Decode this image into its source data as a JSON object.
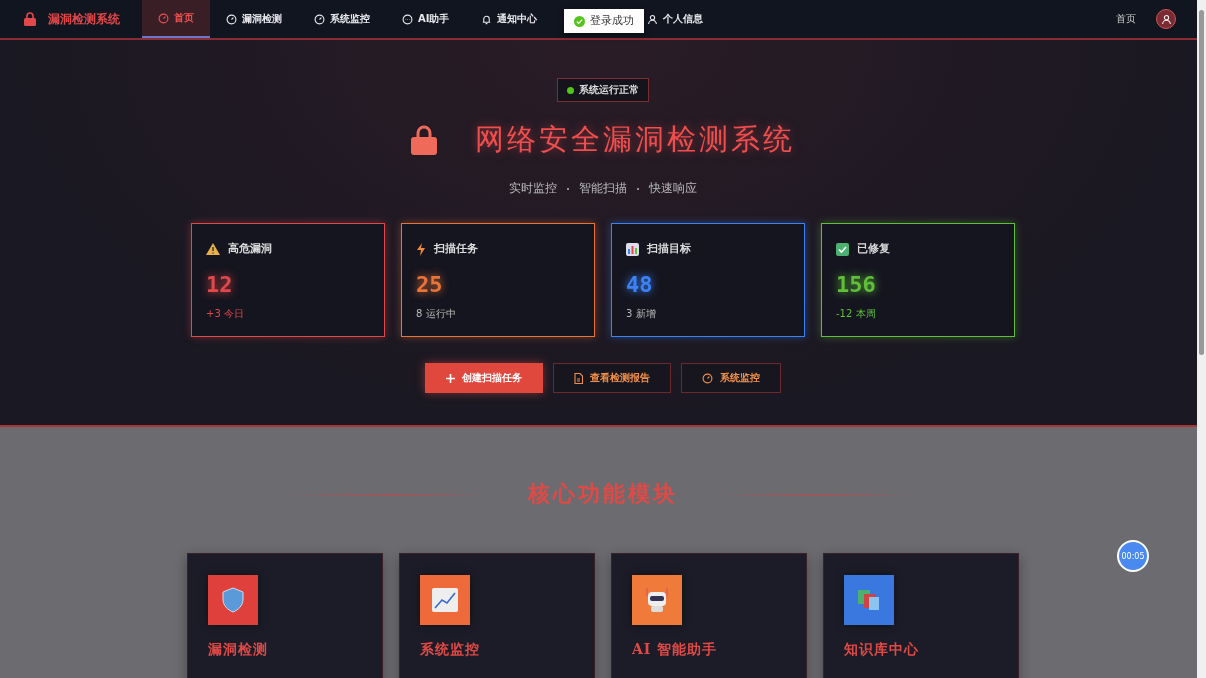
{
  "navbar": {
    "brand": "漏洞检测系统",
    "items": [
      {
        "label": "首页",
        "selected": true
      },
      {
        "label": "漏洞检测",
        "selected": false
      },
      {
        "label": "系统监控",
        "selected": false
      },
      {
        "label": "AI助手",
        "selected": false
      },
      {
        "label": "通知中心",
        "selected": false
      },
      {
        "label": "个人信息",
        "selected": false
      }
    ],
    "breadcrumb": "首页"
  },
  "toast": {
    "text": "登录成功"
  },
  "hero": {
    "status": "系统运行正常",
    "title": "网络安全漏洞检测系统",
    "subtitle": [
      "实时监控",
      "智能扫描",
      "快速响应"
    ],
    "stats": [
      {
        "label": "高危漏洞",
        "value": "12",
        "note": "+3 今日",
        "kind": "warning",
        "color": "#e0484a"
      },
      {
        "label": "扫描任务",
        "value": "25",
        "note": "8 运行中",
        "kind": "bolt",
        "color": "#e8743a"
      },
      {
        "label": "扫描目标",
        "value": "48",
        "note": "3 新增",
        "kind": "chart",
        "color": "#3b82f6"
      },
      {
        "label": "已修复",
        "value": "156",
        "note": "-12 本周",
        "kind": "check",
        "color": "#5fbf3a"
      }
    ],
    "buttons": [
      {
        "label": "创建扫描任务",
        "kind": "primary"
      },
      {
        "label": "查看检测报告",
        "kind": "secondary"
      },
      {
        "label": "系统监控",
        "kind": "secondary"
      }
    ]
  },
  "modules": {
    "title": "核心功能模块",
    "items": [
      {
        "title": "漏洞检测",
        "color": "#e0403c"
      },
      {
        "title": "系统监控",
        "color": "#ee6a3a"
      },
      {
        "title": "AI 智能助手",
        "color": "#f07a3a"
      },
      {
        "title": "知识库中心",
        "color": "#3a78e0"
      }
    ]
  },
  "timer": "00:05"
}
